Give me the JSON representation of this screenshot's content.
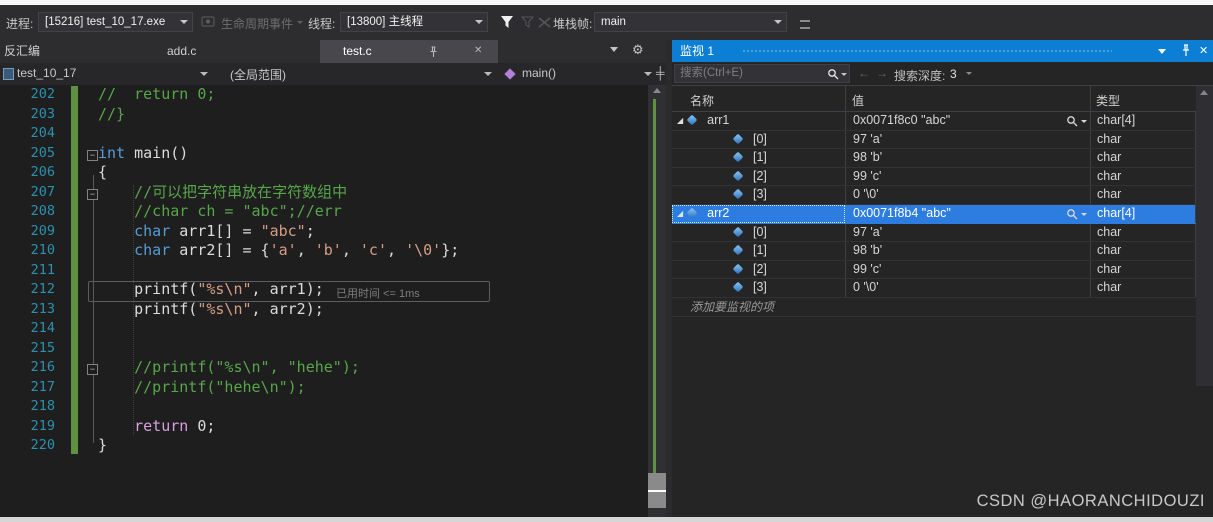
{
  "colors": {
    "editor_bg": "#1e1e1e",
    "panel_bg": "#252526",
    "toolbar_bg": "#2d2d30",
    "focus_title_blue": "#0c7fd4",
    "selection_blue": "#2d7de1",
    "line_number": "#2b91af",
    "keyword": "#569cd6",
    "control_keyword": "#d8a0df",
    "string": "#d69d85",
    "comment": "#57a64a",
    "plain_code": "#dcdcdc",
    "change_bar_green": "#5e9141"
  },
  "toolbar": {
    "process_label": "进程:",
    "process_value": "[15216] test_10_17.exe",
    "lifecycle_label": "生命周期事件",
    "thread_label": "线程:",
    "thread_value": "[13800] 主线程",
    "stackframe_label": "堆栈帧:",
    "stackframe_value": "main"
  },
  "tabs": {
    "items": [
      {
        "label": "反汇编",
        "active": false
      },
      {
        "label": "add.c",
        "active": false
      },
      {
        "label": "test.c",
        "active": true,
        "pinned": true,
        "closable": true
      }
    ]
  },
  "navbar": {
    "project": "test_10_17",
    "scope": "(全局范围)",
    "method": "main()"
  },
  "editor": {
    "current_line": 212,
    "perf_tip": "已用时间 <= 1ms",
    "fold_lines": [
      205,
      207,
      216
    ],
    "lines": [
      {
        "num": 202,
        "segs": [
          [
            "c",
            "//  return 0;"
          ]
        ]
      },
      {
        "num": 203,
        "segs": [
          [
            "c",
            "//}"
          ]
        ]
      },
      {
        "num": 204,
        "segs": []
      },
      {
        "num": 205,
        "segs": [
          [
            "k",
            "int"
          ],
          [
            "p",
            " main()"
          ]
        ]
      },
      {
        "num": 206,
        "segs": [
          [
            "p",
            "{"
          ]
        ]
      },
      {
        "num": 207,
        "segs": [
          [
            "c",
            "    //可以把字符串放在字符数组中"
          ]
        ]
      },
      {
        "num": 208,
        "segs": [
          [
            "c",
            "    //char ch = \"abc\";//err"
          ]
        ]
      },
      {
        "num": 209,
        "segs": [
          [
            "k",
            "    char"
          ],
          [
            "p",
            " arr1[] = "
          ],
          [
            "s",
            "\"abc\""
          ],
          [
            "p",
            ";"
          ]
        ]
      },
      {
        "num": 210,
        "segs": [
          [
            "k",
            "    char"
          ],
          [
            "p",
            " arr2[] = {"
          ],
          [
            "s",
            "'a'"
          ],
          [
            "p",
            ", "
          ],
          [
            "s",
            "'b'"
          ],
          [
            "p",
            ", "
          ],
          [
            "s",
            "'c'"
          ],
          [
            "p",
            ", "
          ],
          [
            "s",
            "'\\0'"
          ],
          [
            "p",
            "};"
          ]
        ]
      },
      {
        "num": 211,
        "segs": []
      },
      {
        "num": 212,
        "segs": [
          [
            "p",
            "    printf("
          ],
          [
            "s",
            "\"%s\\n\""
          ],
          [
            "p",
            ", arr1);"
          ]
        ]
      },
      {
        "num": 213,
        "segs": [
          [
            "p",
            "    printf("
          ],
          [
            "s",
            "\"%s\\n\""
          ],
          [
            "p",
            ", arr2);"
          ]
        ]
      },
      {
        "num": 214,
        "segs": []
      },
      {
        "num": 215,
        "segs": []
      },
      {
        "num": 216,
        "segs": [
          [
            "c",
            "    //printf(\"%s\\n\", \"hehe\");"
          ]
        ]
      },
      {
        "num": 217,
        "segs": [
          [
            "c",
            "    //printf(\"hehe\\n\");"
          ]
        ]
      },
      {
        "num": 218,
        "segs": []
      },
      {
        "num": 219,
        "segs": [
          [
            "ck",
            "    return"
          ],
          [
            "p",
            " 0;"
          ]
        ]
      },
      {
        "num": 220,
        "segs": [
          [
            "p",
            "}"
          ]
        ]
      }
    ]
  },
  "watch": {
    "title": "监视 1",
    "search_placeholder": "搜索(Ctrl+E)",
    "depth_label": "搜索深度:",
    "depth_value": "3",
    "columns": [
      "名称",
      "值",
      "类型"
    ],
    "rows": [
      {
        "name": "arr1",
        "value": "0x0071f8c0 \"abc\"",
        "type": "char[4]",
        "level": 0,
        "expanded": true,
        "magnifier": true,
        "selected": false
      },
      {
        "name": "[0]",
        "value": "97 'a'",
        "type": "char",
        "level": 1
      },
      {
        "name": "[1]",
        "value": "98 'b'",
        "type": "char",
        "level": 1
      },
      {
        "name": "[2]",
        "value": "99 'c'",
        "type": "char",
        "level": 1
      },
      {
        "name": "[3]",
        "value": "0 '\\0'",
        "type": "char",
        "level": 1
      },
      {
        "name": "arr2",
        "value": "0x0071f8b4 \"abc\"",
        "type": "char[4]",
        "level": 0,
        "expanded": true,
        "magnifier": true,
        "selected": true
      },
      {
        "name": "[0]",
        "value": "97 'a'",
        "type": "char",
        "level": 1
      },
      {
        "name": "[1]",
        "value": "98 'b'",
        "type": "char",
        "level": 1
      },
      {
        "name": "[2]",
        "value": "99 'c'",
        "type": "char",
        "level": 1
      },
      {
        "name": "[3]",
        "value": "0 '\\0'",
        "type": "char",
        "level": 1
      }
    ],
    "add_row_label": "添加要监视的项"
  },
  "watermark": "CSDN @HAORANCHIDOUZI"
}
